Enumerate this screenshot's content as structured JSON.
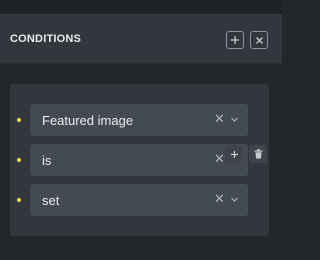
{
  "panel": {
    "title": "CONDITIONS",
    "header_buttons": [
      {
        "icon": "plus-icon"
      },
      {
        "icon": "close-icon"
      }
    ]
  },
  "condition": {
    "rows": [
      {
        "value": "Featured image"
      },
      {
        "value": "is"
      },
      {
        "value": "set"
      }
    ],
    "footer_buttons": [
      {
        "icon": "plus-icon"
      },
      {
        "icon": "trash-icon"
      }
    ]
  },
  "colors": {
    "background": "#23272c",
    "panel": "#32373d",
    "field": "#444a51",
    "bullet": "#f2e24c",
    "text": "#eceef0"
  }
}
